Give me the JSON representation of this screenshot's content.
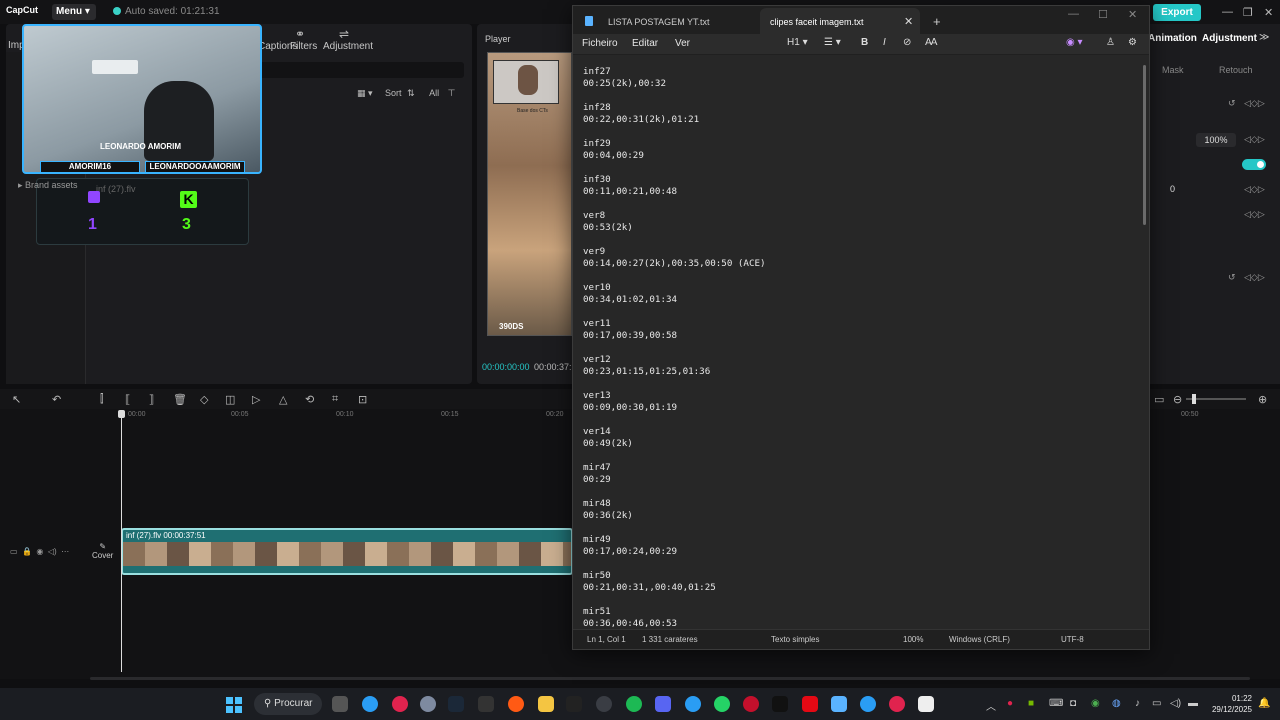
{
  "capcut": {
    "logo": "CapCut",
    "menu_label": "Menu ▾",
    "autosave": "Auto saved: 01:21:31",
    "export_label": "Export",
    "top_tabs": [
      "Import",
      "Captions",
      "Filters",
      "Adjustment"
    ],
    "sort_label": "Sort",
    "all_label": "All",
    "brand_assets": "Brand assets",
    "file_label": "inf (27).flv",
    "player_title": "Player",
    "time_current": "00:00:00:00",
    "time_total": "00:00:37:5",
    "right_tabs": {
      "animation": "Animation",
      "adjustment": "Adjustment"
    },
    "right_subtabs": {
      "mask": "Mask",
      "retouch": "Retouch"
    },
    "scale_value": "100%",
    "offset_value": "0",
    "ticks": [
      "00:00",
      "00:05",
      "00:10",
      "00:15",
      "00:20"
    ],
    "tick_right": "00:50",
    "clip_label": "inf (27).flv   00:00:37:51",
    "cover_label": "Cover",
    "overlay": {
      "cam_name": "LEONARDO AMORIM",
      "handle1": "AMORIM16",
      "handle2": "LEONARDOOAAMORIM",
      "twitch_count": "1",
      "kick_letter": "K",
      "kick_count": "3",
      "video_label": "Base dos CTs",
      "score": "390DS"
    },
    "colors": {
      "accent": "#25c7c7",
      "twitch": "#9146ff",
      "kick": "#53fc18",
      "overlay_border": "#39b4ff"
    }
  },
  "notepad": {
    "tabs": [
      {
        "label": "LISTA POSTAGEM YT.txt",
        "active": false
      },
      {
        "label": "clipes faceit imagem.txt",
        "active": true
      }
    ],
    "menu": [
      "Ficheiro",
      "Editar",
      "Ver"
    ],
    "heading_btn": "H1",
    "content": "inf27\n00:25(2k),00:32\n\ninf28\n00:22,00:31(2k),01:21\n\ninf29\n00:04,00:29\n\ninf30\n00:11,00:21,00:48\n\nver8\n00:53(2k)\n\nver9\n00:14,00:27(2k),00:35,00:50 (ACE)\n\nver10\n00:34,01:02,01:34\n\nver11\n00:17,00:39,00:58\n\nver12\n00:23,01:15,01:25,01:36\n\nver13\n00:09,00:30,01:19\n\nver14\n00:49(2k)\n\nmir47\n00:29\n\nmir48\n00:36(2k)\n\nmir49\n00:17,00:24,00:29\n\nmir50\n00:21,00:31,,00:40,01:25\n\nmir51\n00:36,00:46,00:53",
    "status": {
      "position": "Ln 1, Col 1",
      "chars": "1 331 carateres",
      "format": "Texto simples",
      "zoom": "100%",
      "eol": "Windows (CRLF)",
      "encoding": "UTF-8"
    }
  },
  "taskbar": {
    "search_label": "Procurar",
    "time": "01:22",
    "date": "29/12/2025"
  }
}
